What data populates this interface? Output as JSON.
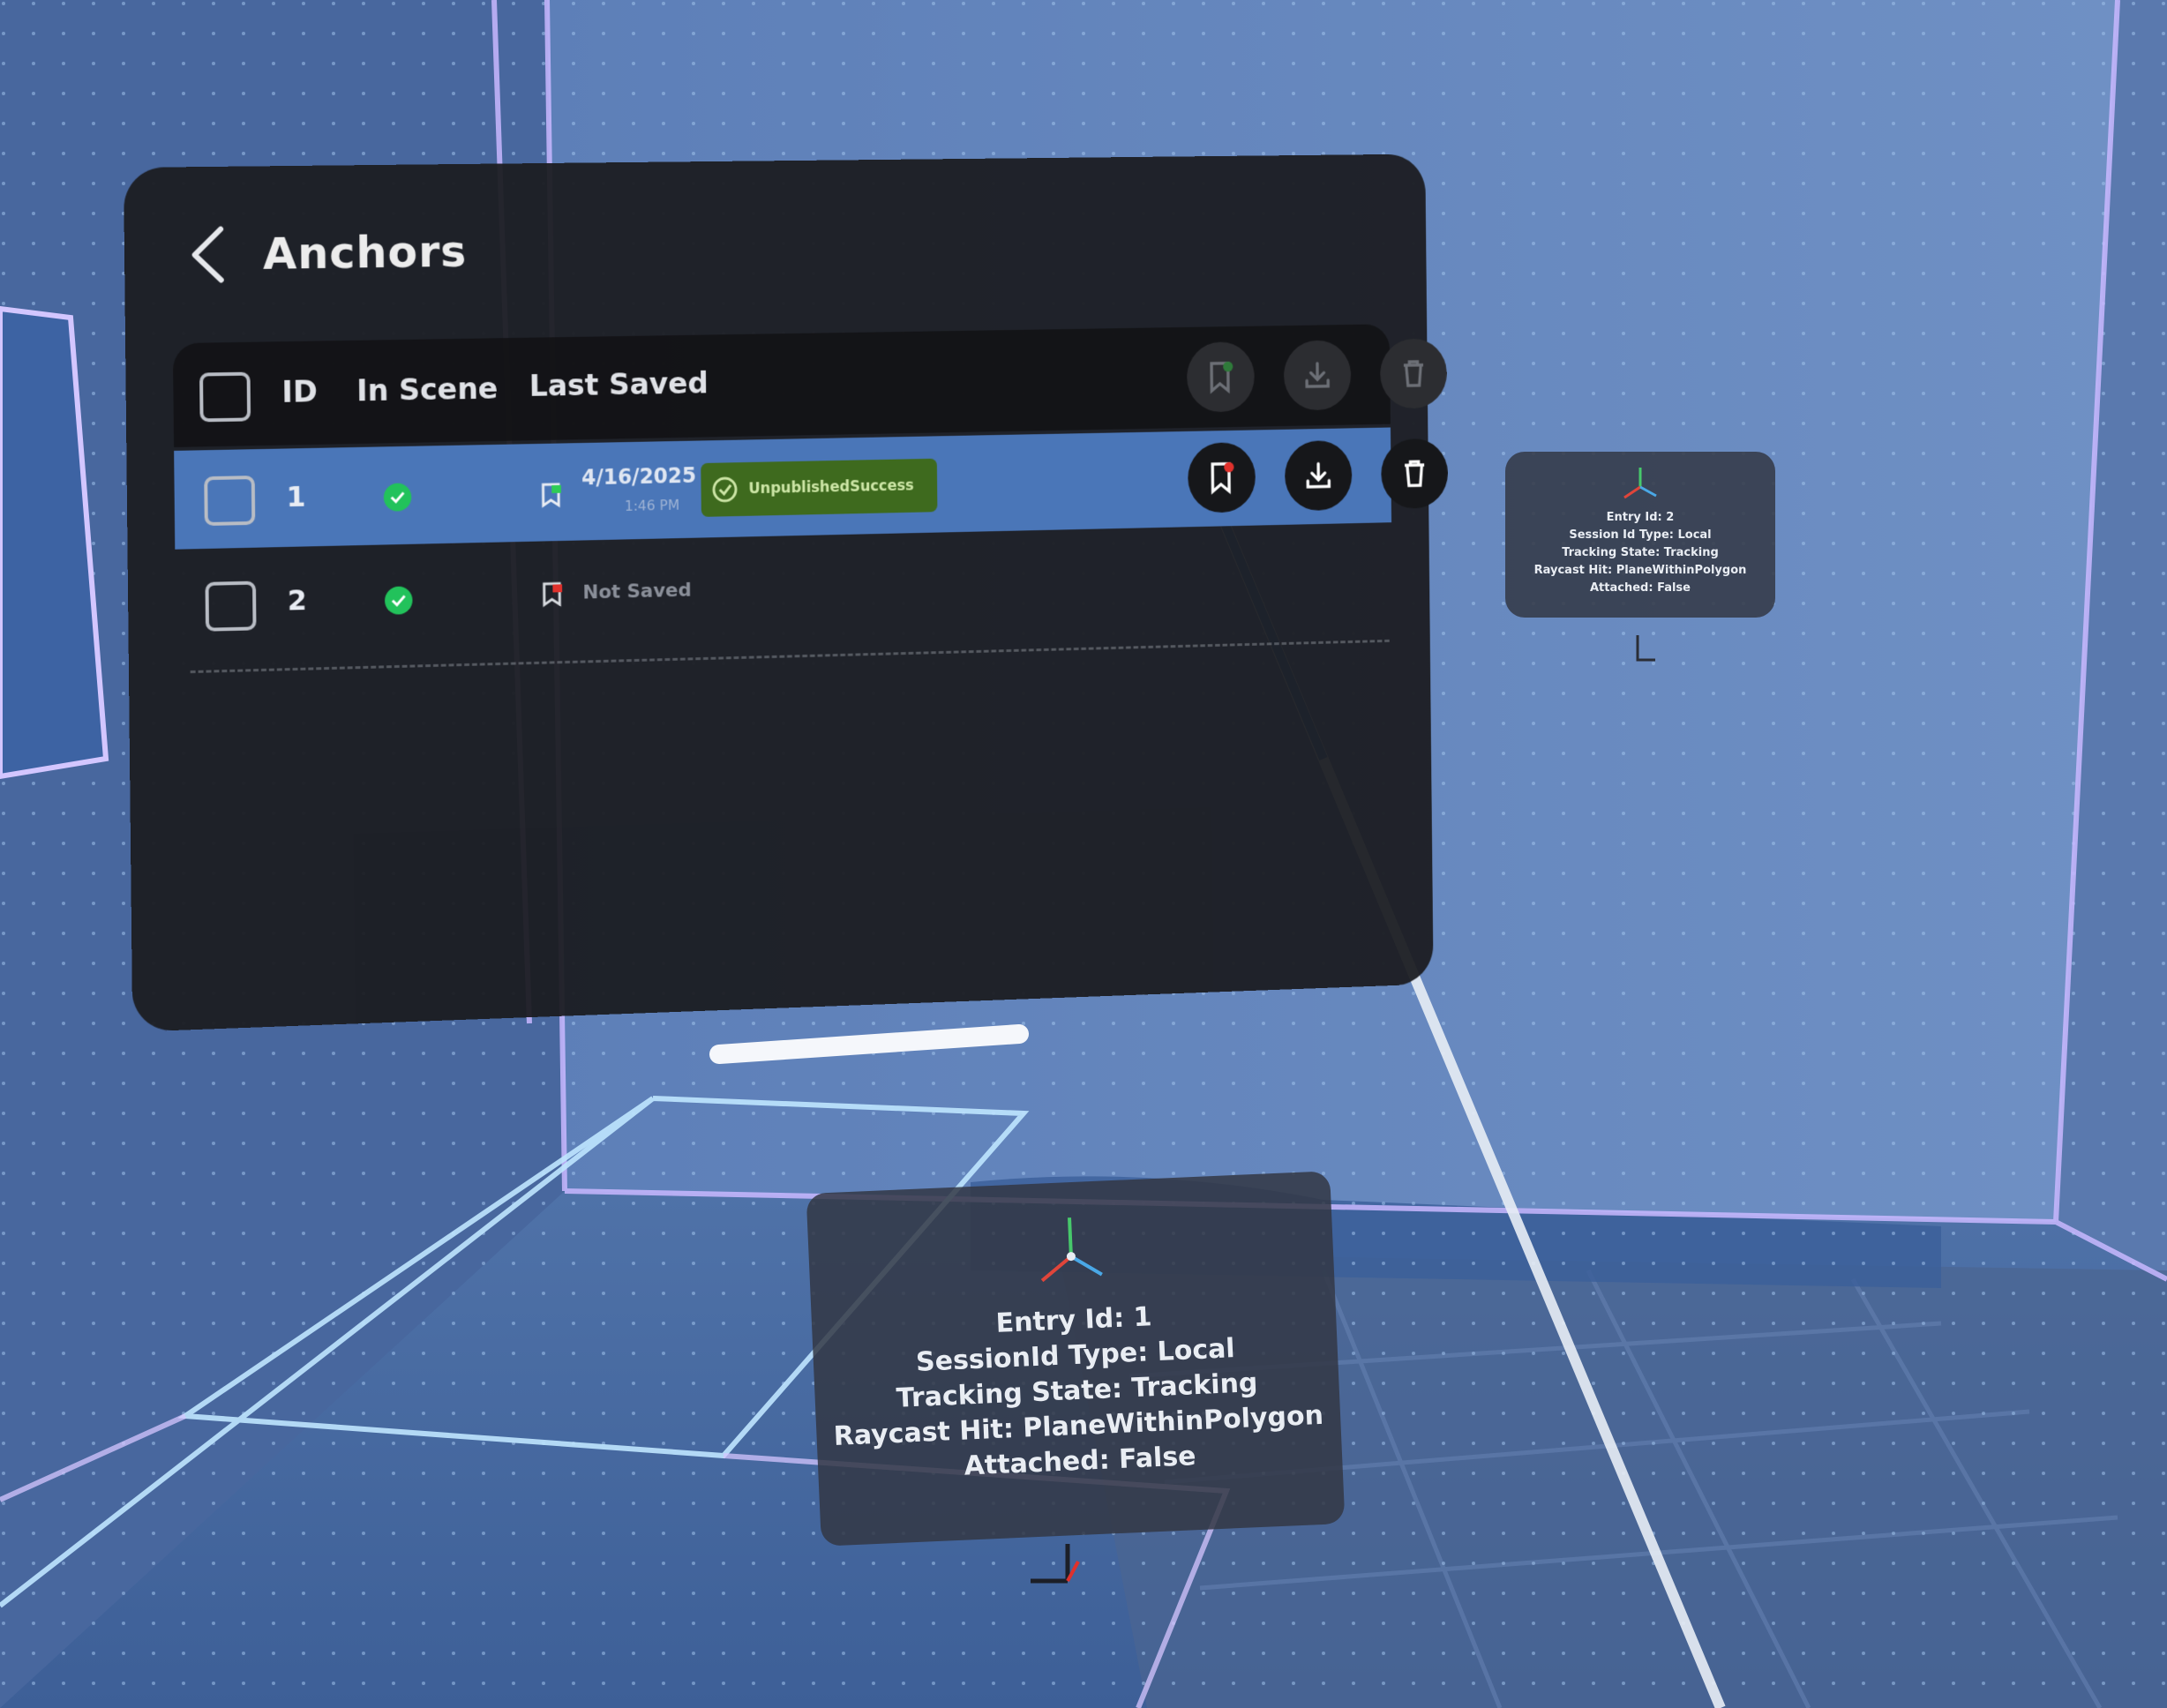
{
  "panel": {
    "title": "Anchors",
    "back_icon": "chevron-left-icon",
    "columns": {
      "id": "ID",
      "in_scene": "In Scene",
      "last_saved": "Last Saved"
    },
    "header_actions": [
      "bookmark-icon",
      "download-icon",
      "trash-icon"
    ],
    "rows": [
      {
        "id": "1",
        "in_scene": true,
        "date": "4/16/2025",
        "time": "1:46 PM",
        "badge": "UnpublishedSuccess",
        "selected": true
      },
      {
        "id": "2",
        "in_scene": true,
        "saved_text": "Not Saved",
        "selected": false
      }
    ]
  },
  "anchor_card_1": {
    "entry": "Entry Id: 1",
    "session": "SessionId Type: Local",
    "tracking": "Tracking State: Tracking",
    "raycast": "Raycast Hit: PlaneWithinPolygon",
    "attached": "Attached: False"
  },
  "anchor_card_2": {
    "entry": "Entry Id: 2",
    "session": "Session Id Type: Local",
    "tracking": "Tracking State: Tracking",
    "raycast": "Raycast Hit: PlaneWithinPolygon",
    "attached": "Attached: False"
  },
  "colors": {
    "panel": "#1b1c20",
    "selected_row": "#4a76b8",
    "in_scene_check": "#22c25b",
    "badge": "#3e6a1e"
  }
}
